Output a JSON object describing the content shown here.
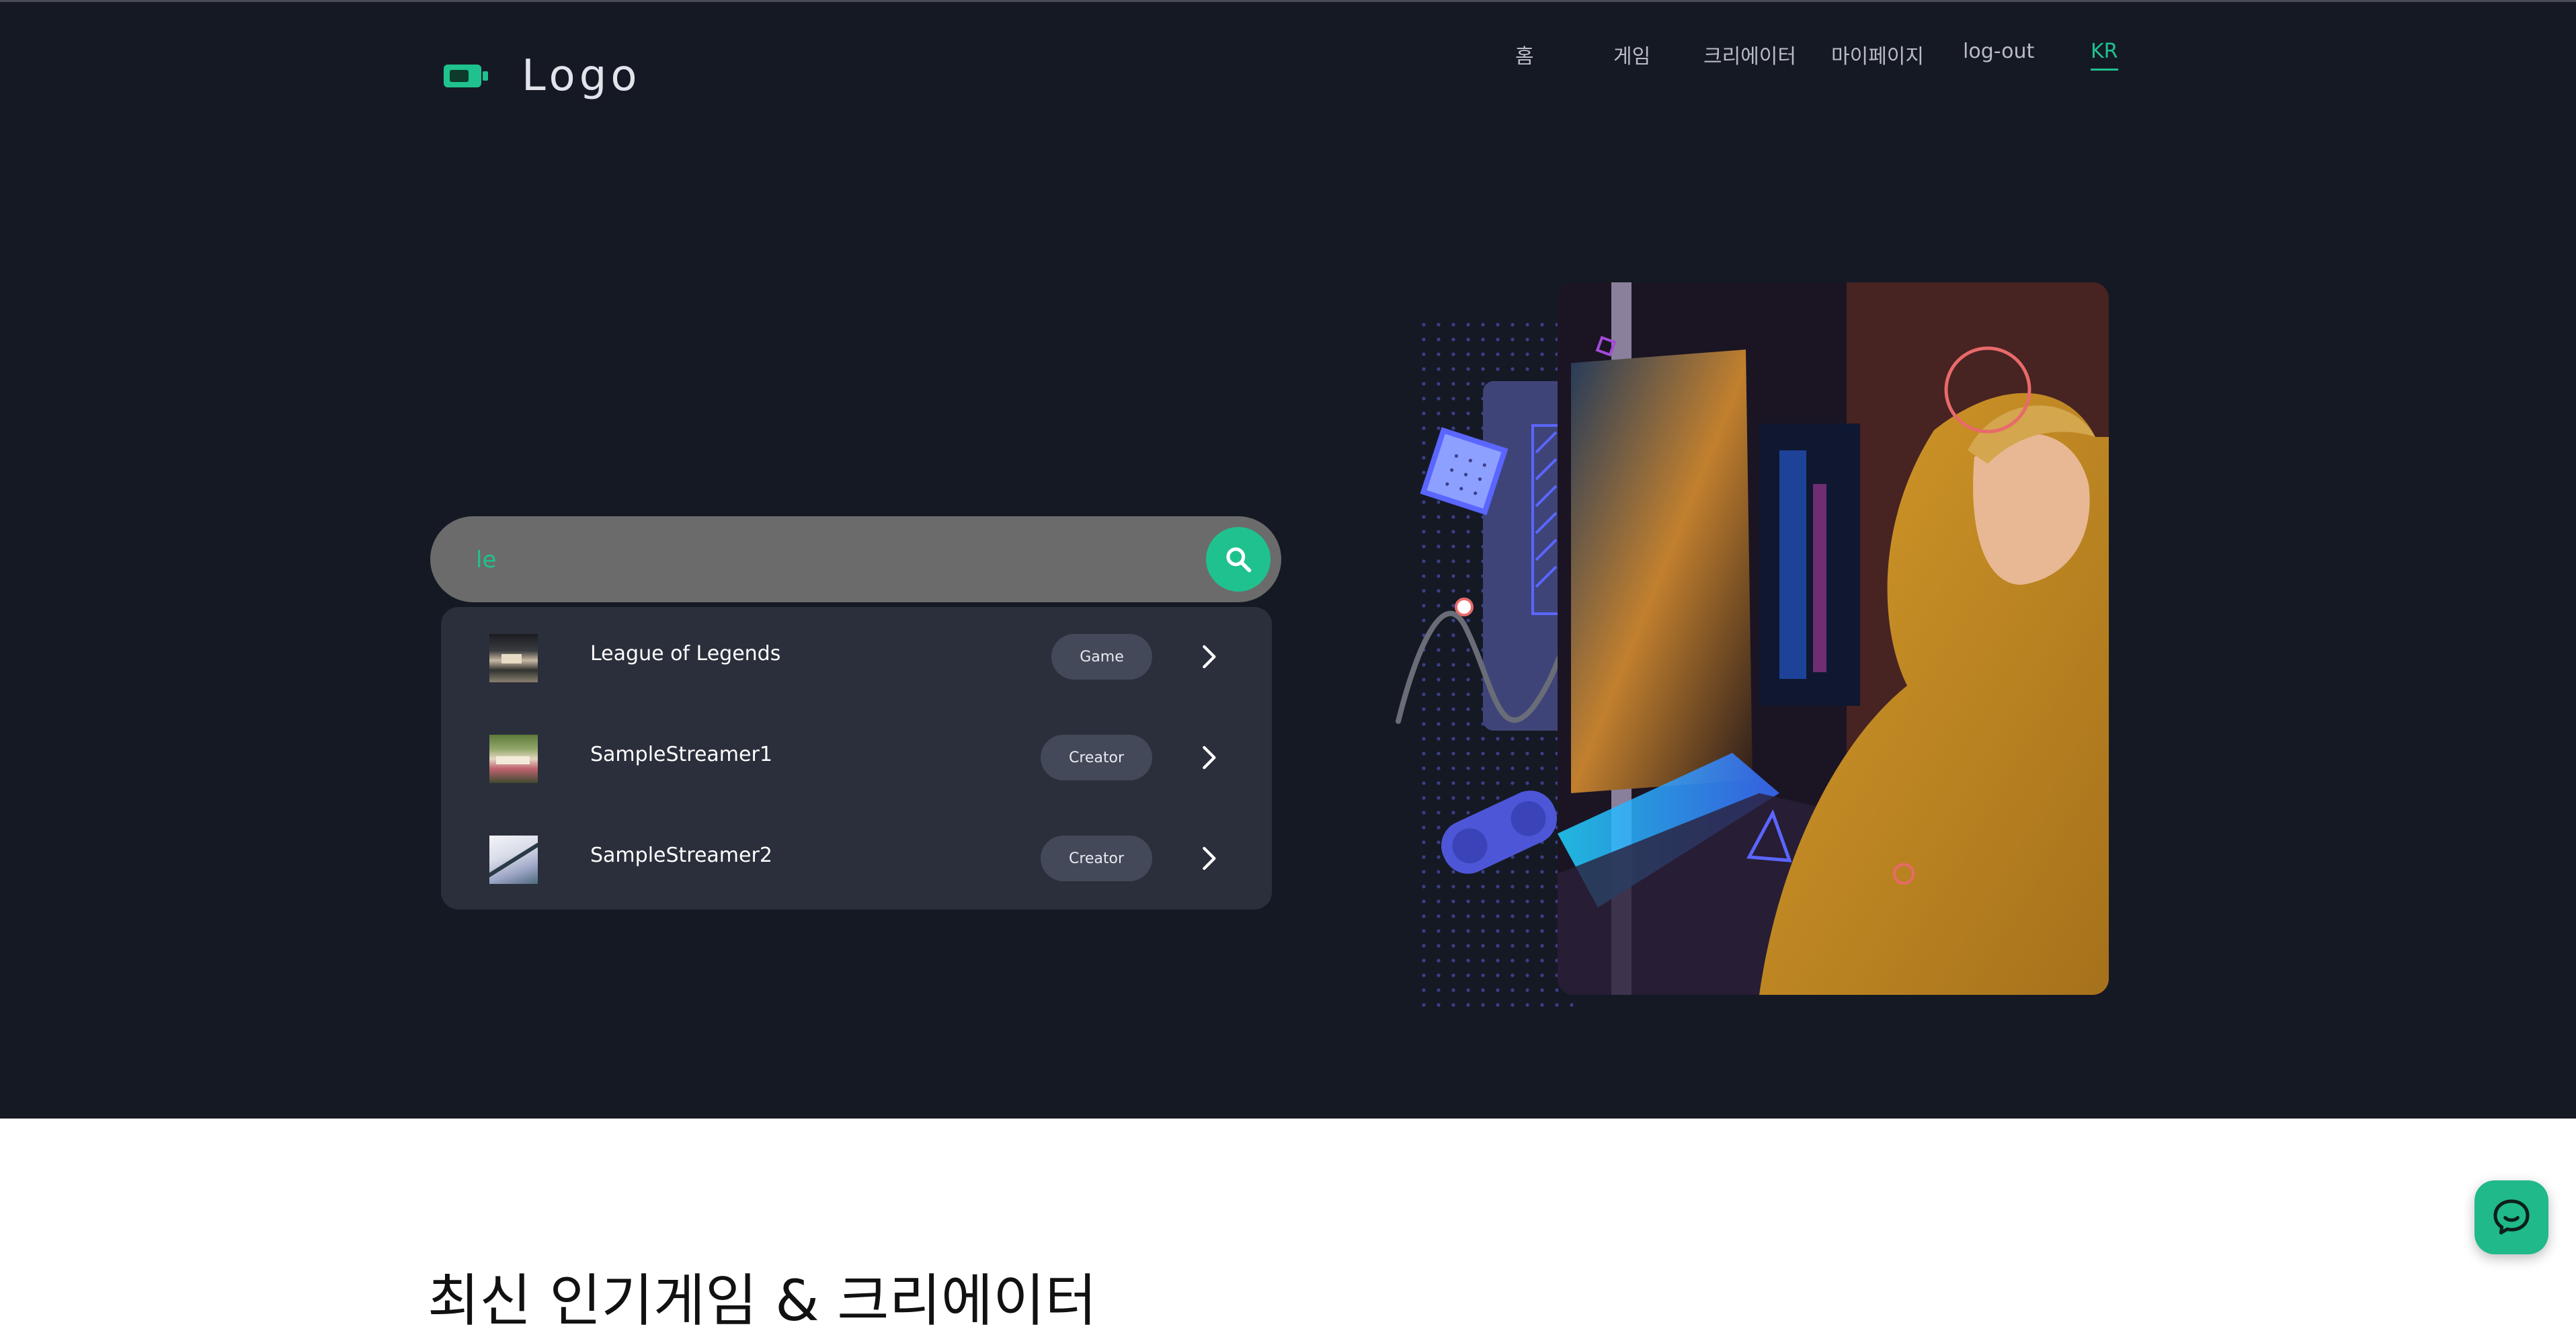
{
  "header": {
    "logo_text": "Logo",
    "nav": [
      {
        "label": "홈"
      },
      {
        "label": "게임"
      },
      {
        "label": "크리에이터"
      },
      {
        "label": "마이페이지"
      },
      {
        "label": "log-out"
      },
      {
        "label": "KR",
        "active": true
      }
    ]
  },
  "search": {
    "value": "le",
    "results": [
      {
        "name": "League of Legends",
        "tag": "Game",
        "thumb": "game-thumbnail"
      },
      {
        "name": "SampleStreamer1",
        "tag": "Creator",
        "thumb": "streamer-thumbnail"
      },
      {
        "name": "SampleStreamer2",
        "tag": "Creator",
        "thumb": "streamer-thumbnail"
      }
    ]
  },
  "section": {
    "title": "최신 인기게임 & 크리에이터"
  },
  "icons": {
    "logo": "battery-icon",
    "search": "search-icon",
    "result_arrow": "chevron-right-icon",
    "chat": "chat-bubble-icon"
  },
  "colors": {
    "hero_bg": "#151924",
    "accent": "#1fc28e",
    "dropdown_bg": "#2b2f3b",
    "search_bg": "#6b6b6b",
    "tag_bg": "#434959"
  }
}
